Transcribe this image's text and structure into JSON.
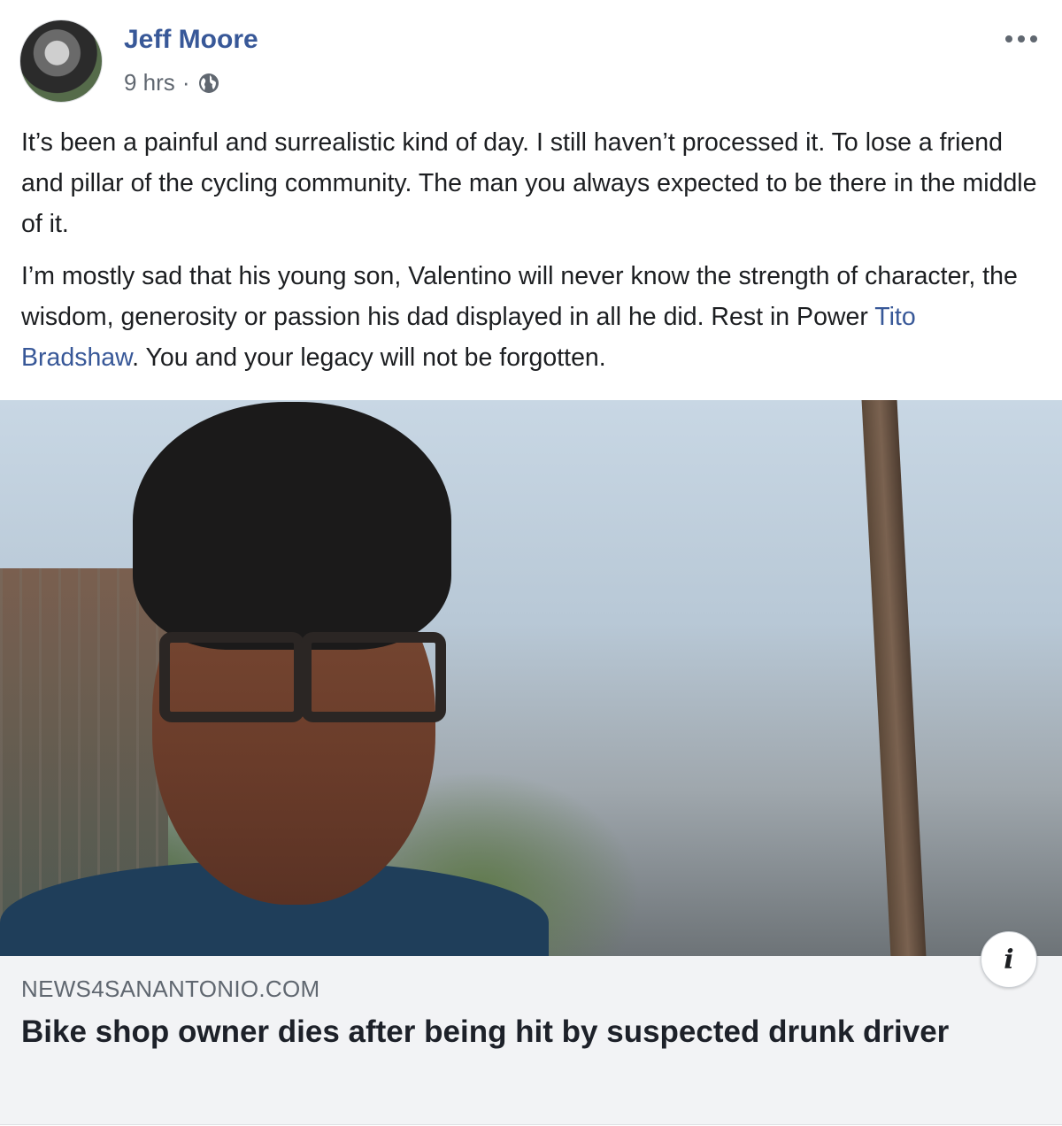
{
  "post": {
    "author": "Jeff Moore",
    "time": "9 hrs",
    "separator": "·",
    "privacy_icon": "globe-icon",
    "menu_icon": "more-horizontal-icon",
    "paragraph1": "It’s been a painful and surrealistic kind of day. I still haven’t processed it. To lose a friend and pillar of the cycling community. The man you always expected to be there in the middle of it.",
    "paragraph2_before": "I’m mostly sad that his young son, Valentino will never know the strength of character, the wisdom, generosity or passion his dad displayed in all he did. Rest in Power ",
    "paragraph2_link": "Tito Bradshaw",
    "paragraph2_after": ". You and your legacy will not be forgotten."
  },
  "link_preview": {
    "domain": "NEWS4SANANTONIO.COM",
    "headline": "Bike shop owner dies after being hit by suspected drunk driver",
    "info_icon": "i"
  },
  "colors": {
    "author": "#385898",
    "link": "#385898",
    "meta": "#606770",
    "preview_bg": "#f2f3f5"
  }
}
